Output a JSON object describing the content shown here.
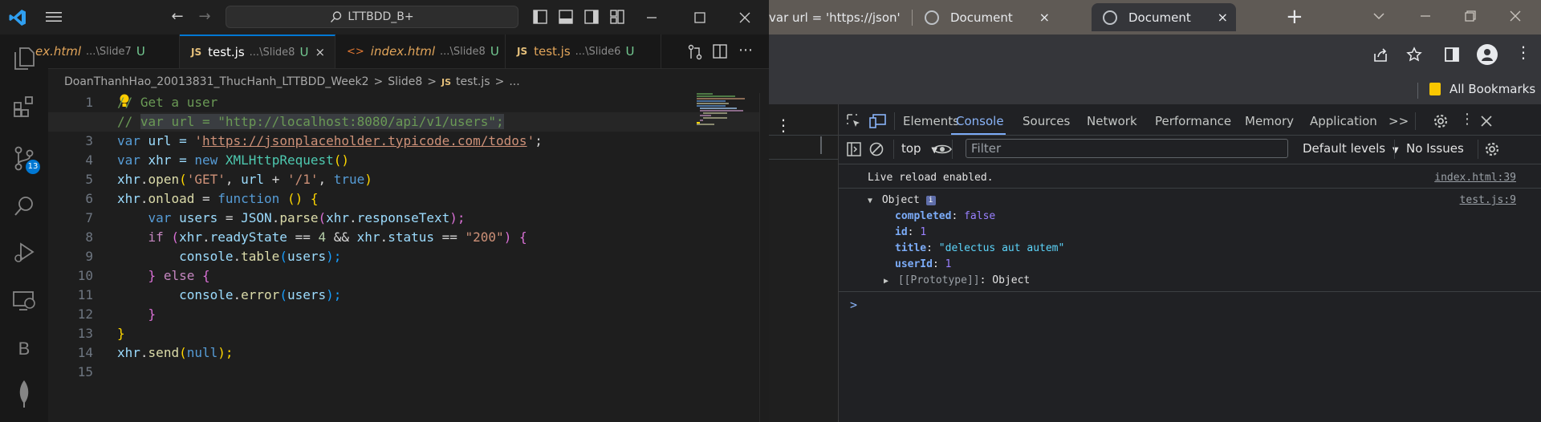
{
  "vscode": {
    "search_text": "LTTBDD_B+",
    "source_control_badge": "13",
    "tabs": [
      {
        "name": "ex.html",
        "path": "...\\Slide7",
        "status": "U"
      },
      {
        "name": "test.js",
        "path": "...\\Slide8",
        "status": "U",
        "close": "×"
      },
      {
        "name": "index.html",
        "path": "...\\Slide8",
        "status": "U"
      },
      {
        "name": "test.js",
        "path": "...\\Slide6",
        "status": "U"
      }
    ],
    "js_badge": "JS",
    "html_badge": "<>",
    "breadcrumb": {
      "folder": "DoanThanhHao_20013831_ThucHanh_LTTBDD_Week2",
      "sep": ">",
      "slide": "Slide8",
      "file": "test.js",
      "ellipsis": "..."
    },
    "line_numbers": [
      "1",
      "2",
      "3",
      "4",
      "5",
      "6",
      "7",
      "8",
      "9",
      "10",
      "11",
      "12",
      "13",
      "14",
      "15"
    ],
    "code": {
      "l1": "// Get a user",
      "l2_comment": "// ",
      "l2_code": "var url = \"http://localhost:8080/api/v1/users\";",
      "l3": [
        "var",
        " url = ",
        "'",
        "https://jsonplaceholder.typicode.com/todos",
        "'",
        ";"
      ],
      "l4": [
        "var",
        " xhr = ",
        "new",
        " ",
        "XMLHttpRequest",
        "()"
      ],
      "l5": [
        "xhr",
        ".",
        "open",
        "(",
        "'GET'",
        ", ",
        "url",
        " + ",
        "'/1'",
        ", ",
        "true",
        ")"
      ],
      "l6": [
        "xhr",
        ".",
        "onload",
        " = ",
        "function",
        " () {"
      ],
      "l7": [
        "    ",
        "var",
        " ",
        "users",
        " = ",
        "JSON",
        ".",
        "parse",
        "(",
        "xhr",
        ".",
        "responseText",
        ");"
      ],
      "l8": [
        "    ",
        "if",
        " (",
        "xhr",
        ".",
        "readyState",
        " == ",
        "4",
        " && ",
        "xhr",
        ".",
        "status",
        " == ",
        "\"200\"",
        ") {"
      ],
      "l9": [
        "        ",
        "console",
        ".",
        "table",
        "(",
        "users",
        ");"
      ],
      "l10": [
        "    ",
        "}",
        " ",
        "else",
        " {"
      ],
      "l11": [
        "        ",
        "console",
        ".",
        "error",
        "(",
        "users",
        ");"
      ],
      "l12": [
        "    ",
        "}"
      ],
      "l13": [
        "}"
      ],
      "l14": [
        "xhr",
        ".",
        "send",
        "(",
        "null",
        ");"
      ]
    }
  },
  "chrome": {
    "tabs": [
      {
        "title": "var url = 'https://json'"
      },
      {
        "title": "Document",
        "close": "×"
      },
      {
        "title": "Document",
        "close": "×"
      }
    ],
    "new_tab": "+",
    "all_bookmarks": "All Bookmarks",
    "devtools": {
      "tabs": [
        "Elements",
        "Console",
        "Sources",
        "Network",
        "Performance",
        "Memory",
        "Application"
      ],
      "active_tab": "Console",
      "more": ">>",
      "context": "top",
      "filter_placeholder": "Filter",
      "default_levels": "Default levels",
      "no_issues": "No Issues",
      "console": {
        "reload_msg": "Live reload enabled.",
        "reload_src": "index.html:39",
        "object_label": "Object",
        "object_src": "test.js:9",
        "info_badge": "i",
        "props": [
          {
            "key": "completed",
            "value": "false"
          },
          {
            "key": "id",
            "value": "1"
          },
          {
            "key": "title",
            "value": "\"delectus aut autem\""
          },
          {
            "key": "userId",
            "value": "1"
          }
        ],
        "prototype_key": "[[Prototype]]",
        "prototype_value": "Object",
        "prompt": ">"
      }
    }
  }
}
